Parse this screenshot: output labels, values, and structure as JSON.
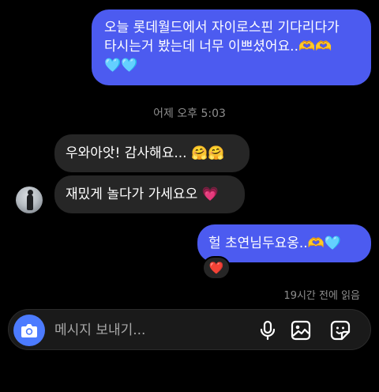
{
  "messages": {
    "outgoing_1": {
      "line_1": "오늘 롯데월드에서 자이로스핀 기다리다가",
      "line_2": "타시는거 봤는데 너무 이쁘셨어요..",
      "emoji_line_2": "🫶🫶",
      "line_3_emoji": "🩵🩵"
    },
    "timestamp": "어제 오후 5:03",
    "incoming_1": {
      "text": "우와아앗! 감사해요...",
      "emoji": "🤗🤗"
    },
    "incoming_2": {
      "text": "재밌게 놀다가 가세요오",
      "emoji": "💗"
    },
    "outgoing_2": {
      "text": "헐 초연님두요옹..",
      "emoji": "🫶🩵"
    },
    "reaction": "❤️",
    "seen": "19시간 전에 읽음"
  },
  "composer": {
    "placeholder": "메시지 보내기..."
  },
  "icons": {
    "camera": "camera-icon",
    "mic": "microphone-icon",
    "gallery": "image-gallery-icon",
    "sticker": "sticker-icon"
  },
  "colors": {
    "outgoing_bubble": "#4c5bf0",
    "incoming_bubble": "#262626",
    "camera_button": "#4c7bff",
    "meta_text": "#8e8e8e"
  }
}
